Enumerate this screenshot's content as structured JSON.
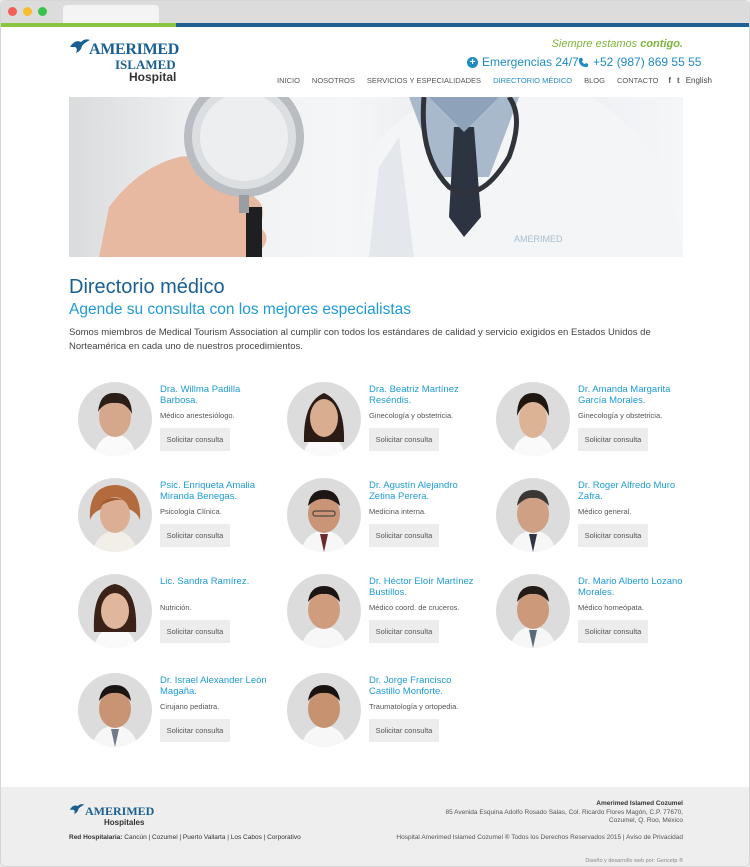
{
  "header": {
    "logo_line1": "AMERIMED",
    "logo_line2": "ISLAMED",
    "logo_line3": "Hospital",
    "tagline_normal": "Siempre estamos ",
    "tagline_bold": "contigo.",
    "emergency_label": "Emergencias 24/7",
    "phone": "+52 (987) 869 55 55"
  },
  "nav": {
    "items": [
      "Inicio",
      "Nosotros",
      "Servicios y especialidades",
      "Directorio médico",
      "Blog",
      "Contacto"
    ],
    "active": "Directorio médico",
    "social": [
      "f",
      "t"
    ],
    "language": "English"
  },
  "content": {
    "title": "Directorio médico",
    "subtitle": "Agende su consulta con los mejores especialistas",
    "intro": "Somos miembros de Medical Tourism Association al cumplir con todos los estándares de calidad y servicio exigidos en Estados Unidos de Norteamérica en cada uno de nuestros procedimientos."
  },
  "doctors": [
    {
      "name": "Dra. Willma Padilla Barbosa.",
      "specialty": "Médico anestesiólogo.",
      "button": "Solicitar consulta"
    },
    {
      "name": "Dra. Beatriz Martínez Reséndis.",
      "specialty": "Ginecología y obstetricia.",
      "button": "Solicitar consulta"
    },
    {
      "name": "Dr. Amanda Margarita García Morales.",
      "specialty": "Ginecología y obstetricia.",
      "button": "Solicitar consulta"
    },
    {
      "name": "Psic. Enriqueta Amalia Miranda Benegas.",
      "specialty": "Psicología Clínica.",
      "button": "Solicitar consulta"
    },
    {
      "name": "Dr. Agustín Alejandro Zetina Perera.",
      "specialty": "Medicina interna.",
      "button": "Solicitar consulta"
    },
    {
      "name": "Dr. Roger Alfredo Muro Zafra.",
      "specialty": "Médico general.",
      "button": "Solicitar consulta"
    },
    {
      "name": "Lic. Sandra Ramírez.",
      "specialty": "Nutrición.",
      "button": "Solicitar consulta"
    },
    {
      "name": "Dr. Héctor Eloír Martínez Bustillos.",
      "specialty": "Médico coord. de cruceros.",
      "button": "Solicitar consulta"
    },
    {
      "name": "Dr. Mario Alberto Lozano Morales.",
      "specialty": "Médico homeópata.",
      "button": "Solicitar consulta"
    },
    {
      "name": "Dr. Israel Alexander León Magaña.",
      "specialty": "Cirujano pediatra.",
      "button": "Solicitar consulta"
    },
    {
      "name": "Dr. Jorge Francisco Castillo Monforte.",
      "specialty": "Traumatología y ortopedia.",
      "button": "Solicitar consulta"
    }
  ],
  "footer": {
    "logo_line1": "AMERIMED",
    "logo_line2": "Hospitales",
    "network_label": "Red Hospitalaria:",
    "network_links": "Cancún | Cozumel | Puerto Vallarta | Los Cabos | Corporativo",
    "address_title": "Amerimed Islamed Cozumel",
    "address": "85 Avenida Esquina Adolfo Rosado Salas, Col. Ricardo Flores Magón, C.P. 77670, Cozumel, Q. Roo, México",
    "legal": "Hospital Amerimed Islamed Cozumel ® Todos los Derechos Reservados 2015 | Aviso de Privacidad",
    "credit": "Diseño y desarrollo web por: Gencetp ®"
  },
  "colors": {
    "primary_blue": "#1a5f92",
    "accent_blue": "#1e9bd7",
    "green": "#8bc53f"
  }
}
